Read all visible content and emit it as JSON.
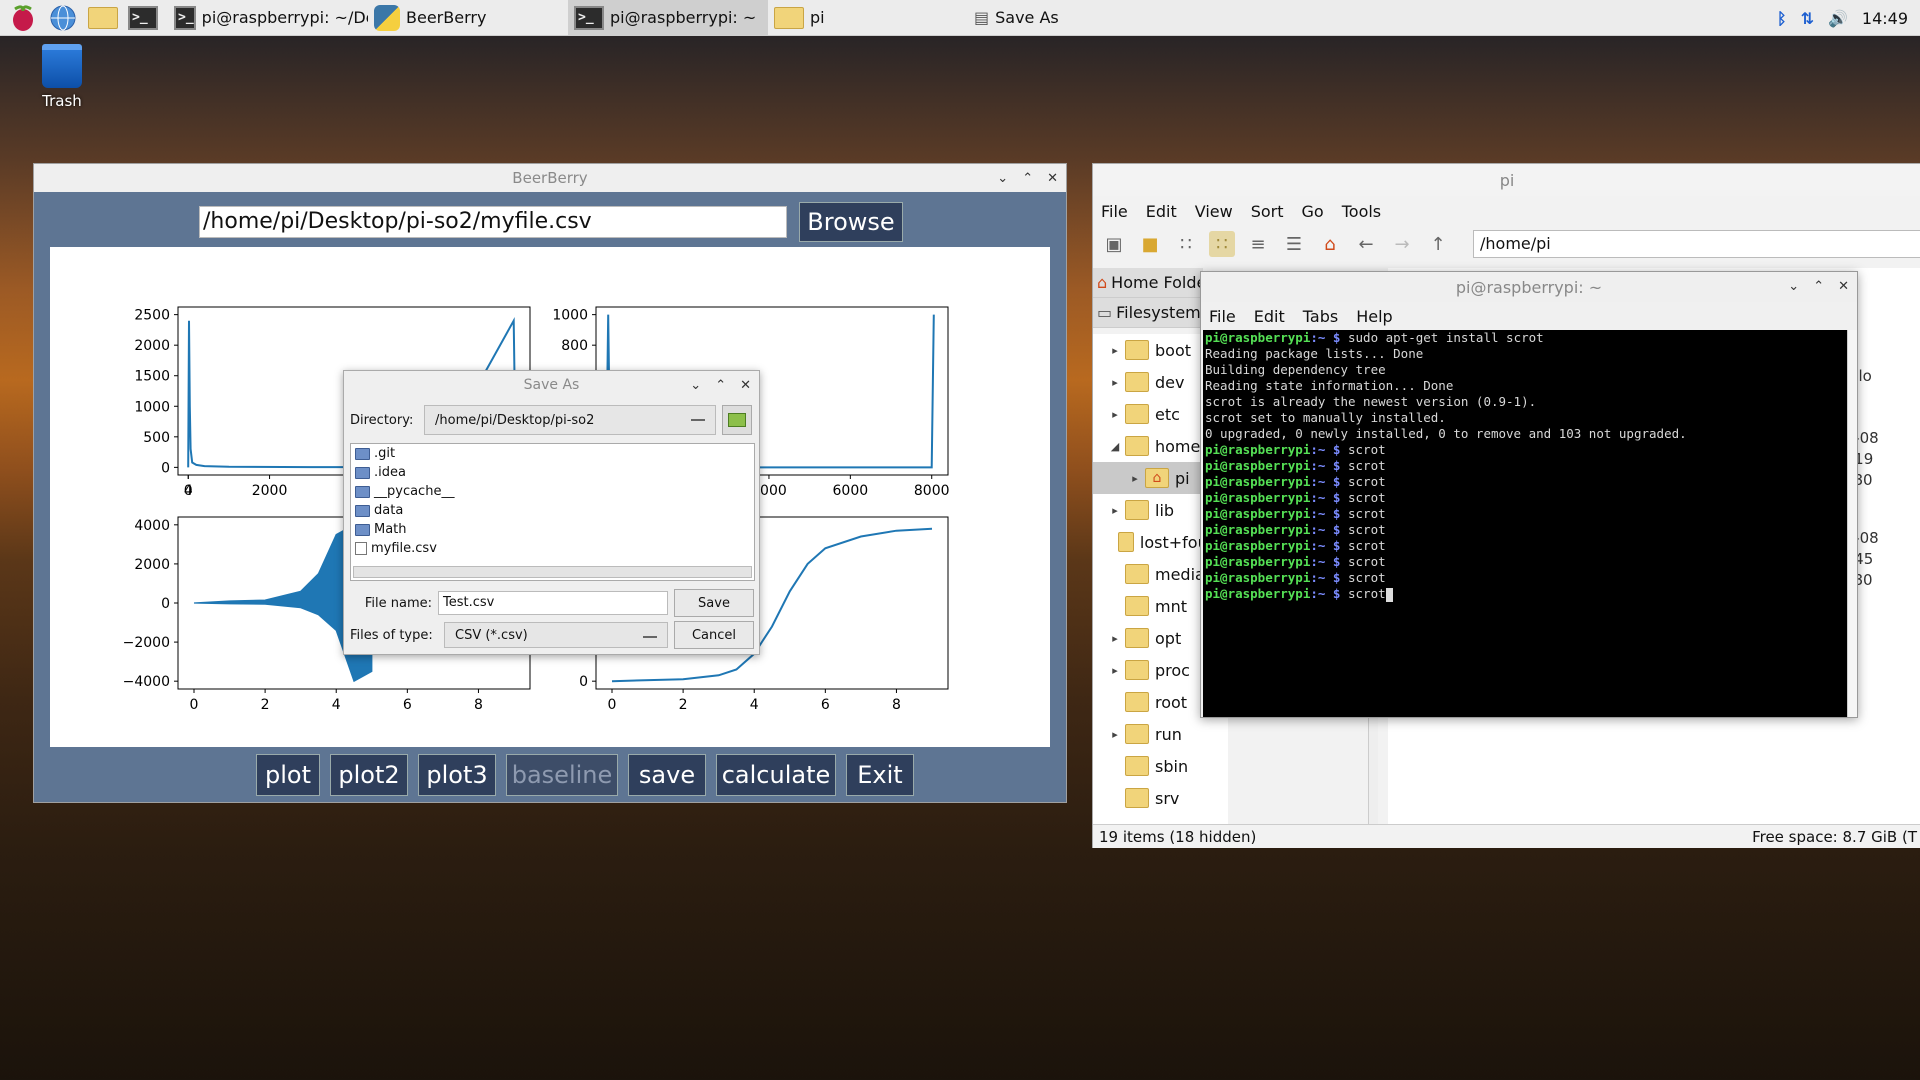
{
  "taskbar": {
    "tasks": [
      {
        "label": "pi@raspberrypi: ~/De...",
        "icon": "terminal-icon"
      },
      {
        "label": "BeerBerry",
        "icon": "python-icon"
      },
      {
        "label": "pi@raspberrypi: ~",
        "icon": "terminal-icon"
      },
      {
        "label": "pi",
        "icon": "folder-icon"
      },
      {
        "label": "Save As",
        "icon": "window-icon"
      }
    ],
    "clock": "14:49"
  },
  "desktop": {
    "trash_label": "Trash"
  },
  "beerberry": {
    "title": "BeerBerry",
    "path": "/home/pi/Desktop/pi-so2/myfile.csv",
    "browse": "Browse",
    "buttons": [
      "plot",
      "plot2",
      "plot3",
      "baseline",
      "save",
      "calculate",
      "Exit"
    ],
    "accent": "#2f3f5c"
  },
  "chart_data": [
    {
      "type": "line",
      "position": "top-left",
      "ylim": [
        0,
        2500
      ],
      "yticks": [
        "0",
        "500",
        "1000",
        "1500",
        "2000",
        "2500"
      ],
      "xticks": [
        "0",
        "2000",
        "4"
      ],
      "x": [
        0,
        20,
        40,
        60,
        100,
        200,
        400,
        1000,
        3000,
        6000,
        8000,
        8050
      ],
      "y": [
        0,
        2400,
        1000,
        300,
        80,
        40,
        20,
        10,
        5,
        5,
        2400,
        0
      ]
    },
    {
      "type": "line",
      "position": "top-right",
      "ylim": [
        0,
        1000
      ],
      "yticks": [
        "800",
        "1000"
      ],
      "xticks": [
        "4000",
        "6000",
        "8000"
      ],
      "x": [
        0,
        50,
        100,
        8000,
        8050
      ],
      "y": [
        0,
        1000,
        0,
        0,
        1000
      ]
    },
    {
      "type": "area",
      "position": "bottom-left",
      "ylim": [
        -4000,
        4000
      ],
      "yticks": [
        "4000",
        "2000",
        "0",
        "−2000",
        "−4000"
      ],
      "xticks": [
        "0",
        "2",
        "4",
        "6",
        "8"
      ],
      "x": [
        0,
        1,
        2,
        3,
        3.5,
        4,
        4.5,
        5
      ],
      "y": [
        0,
        100,
        150,
        600,
        1500,
        3500,
        -4000,
        -3500
      ]
    },
    {
      "type": "line",
      "position": "bottom-right",
      "ylim": [
        0,
        4000
      ],
      "yticks": [
        "0"
      ],
      "xticks": [
        "0",
        "2",
        "4",
        "6",
        "8"
      ],
      "x": [
        0,
        2,
        3,
        3.5,
        4,
        4.5,
        5,
        5.5,
        6,
        7,
        8,
        9
      ],
      "y": [
        0,
        50,
        150,
        300,
        700,
        1400,
        2300,
        3000,
        3400,
        3700,
        3850,
        3900
      ]
    }
  ],
  "saveas": {
    "title": "Save As",
    "directory_label": "Directory:",
    "directory": "/home/pi/Desktop/pi-so2",
    "files": [
      {
        "name": ".git",
        "type": "folder"
      },
      {
        "name": ".idea",
        "type": "folder"
      },
      {
        "name": "__pycache__",
        "type": "folder"
      },
      {
        "name": "data",
        "type": "folder"
      },
      {
        "name": "Math",
        "type": "folder"
      },
      {
        "name": "myfile.csv",
        "type": "file"
      }
    ],
    "filename_label": "File name:",
    "filename": "Test.csv",
    "filetype_label": "Files of type:",
    "filetype": "CSV (*.csv)",
    "save": "Save",
    "cancel": "Cancel"
  },
  "filemanager": {
    "title": "pi",
    "menu": [
      "File",
      "Edit",
      "View",
      "Sort",
      "Go",
      "Tools"
    ],
    "address": "/home/pi",
    "side_headers": [
      "Home Folder",
      "Filesystem"
    ],
    "tree": [
      {
        "name": "boot",
        "arrow": true
      },
      {
        "name": "dev",
        "arrow": true
      },
      {
        "name": "etc",
        "arrow": true
      },
      {
        "name": "home",
        "arrow": true,
        "open": true
      },
      {
        "name": "pi",
        "arrow": true,
        "child": true,
        "selected": true
      },
      {
        "name": "lib",
        "arrow": true
      },
      {
        "name": "lost+found",
        "arrow": false
      },
      {
        "name": "media",
        "arrow": false
      },
      {
        "name": "mnt",
        "arrow": false
      },
      {
        "name": "opt",
        "arrow": true
      },
      {
        "name": "proc",
        "arrow": true
      },
      {
        "name": "root",
        "arrow": false
      },
      {
        "name": "run",
        "arrow": true
      },
      {
        "name": "sbin",
        "arrow": false
      },
      {
        "name": "srv",
        "arrow": false
      }
    ],
    "right_items": [
      "Downlo",
      "2020-08",
      "144919",
      "0x1080",
      "2020-08",
      "144745",
      "0x1080"
    ],
    "status_left": "19 items (18 hidden)",
    "status_right": "Free space: 8.7 GiB (T"
  },
  "terminal": {
    "title": "pi@raspberrypi: ~",
    "menu": [
      "File",
      "Edit",
      "Tabs",
      "Help"
    ],
    "prompt": "pi@raspberrypi",
    "lines": [
      {
        "cmd": "sudo apt-get install scrot"
      },
      {
        "out": "Reading package lists... Done"
      },
      {
        "out": "Building dependency tree"
      },
      {
        "out": "Reading state information... Done"
      },
      {
        "out": "scrot is already the newest version (0.9-1)."
      },
      {
        "out": "scrot set to manually installed."
      },
      {
        "out": "0 upgraded, 0 newly installed, 0 to remove and 103 not upgraded."
      },
      {
        "cmd": "scrot"
      },
      {
        "cmd": "scrot"
      },
      {
        "cmd": "scrot"
      },
      {
        "cmd": "scrot"
      },
      {
        "cmd": "scrot"
      },
      {
        "cmd": "scrot"
      },
      {
        "cmd": "scrot"
      },
      {
        "cmd": "scrot"
      },
      {
        "cmd": "scrot"
      },
      {
        "cmd": "scrot"
      }
    ]
  }
}
